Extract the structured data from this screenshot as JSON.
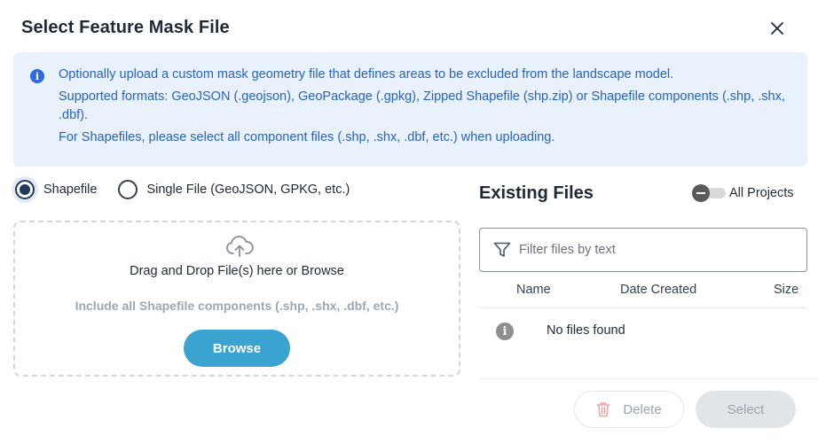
{
  "dialog": {
    "title": "Select Feature Mask File"
  },
  "info": {
    "line1": "Optionally upload a custom mask geometry file that defines areas to be excluded from the landscape model.",
    "line2": "Supported formats: GeoJSON (.geojson), GeoPackage (.gpkg), Zipped Shapefile (shp.zip) or Shapefile components (.shp, .shx, .dbf).",
    "line3": "For Shapefiles, please select all component files (.shp, .shx, .dbf, etc.) when uploading."
  },
  "upload_mode": {
    "options": [
      {
        "label": "Shapefile",
        "selected": true
      },
      {
        "label": "Single File (GeoJSON, GPKG, etc.)",
        "selected": false
      }
    ]
  },
  "dropzone": {
    "text": "Drag and Drop File(s) here or Browse",
    "hint": "Include all Shapefile components (.shp, .shx, .dbf, etc.)",
    "browse_label": "Browse"
  },
  "existing_files": {
    "title": "Existing Files",
    "toggle_label": "All Projects",
    "toggle_on": false,
    "filter_placeholder": "Filter files by text",
    "columns": [
      "Name",
      "Date Created",
      "Size"
    ],
    "empty_text": "No files found"
  },
  "footer": {
    "delete_label": "Delete",
    "select_label": "Select"
  },
  "colors": {
    "accent": "#3aa3cf",
    "info_bg": "#e9f1fc",
    "info_text": "#2563c9"
  }
}
